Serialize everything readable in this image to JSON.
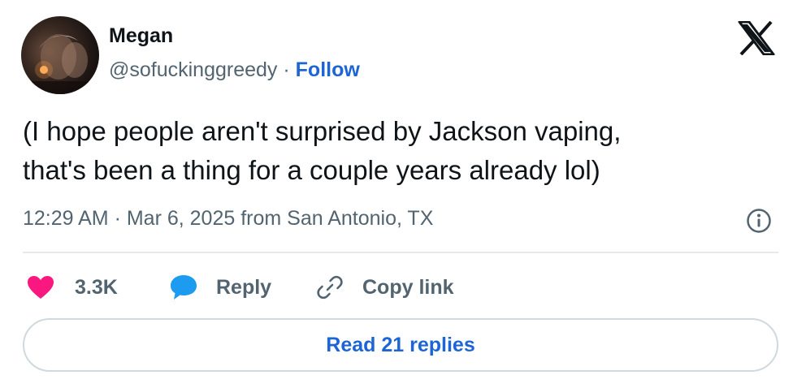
{
  "author": {
    "display_name": "Megan",
    "handle": "@sofuckinggreedy",
    "separator": " · ",
    "follow_label": "Follow"
  },
  "tweet": {
    "text_line1": "(I hope people aren't surprised by Jackson vaping,",
    "text_line2": "that's been a thing for a couple years already lol)",
    "timestamp": "12:29 AM · Mar 6, 2025 from San Antonio, TX"
  },
  "actions": {
    "likes_count": "3.3K",
    "reply_label": "Reply",
    "copy_link_label": "Copy link"
  },
  "footer": {
    "read_replies_label": "Read 21 replies"
  },
  "icons": {
    "brand": "x-logo-icon",
    "info": "info-icon",
    "like": "heart-icon",
    "reply": "speech-bubble-icon",
    "copy": "link-icon"
  },
  "colors": {
    "like": "#f91880",
    "reply": "#1d9bf0",
    "link": "#1d65d4",
    "muted": "#536471",
    "text": "#0f1419",
    "border": "#cfd9de"
  }
}
